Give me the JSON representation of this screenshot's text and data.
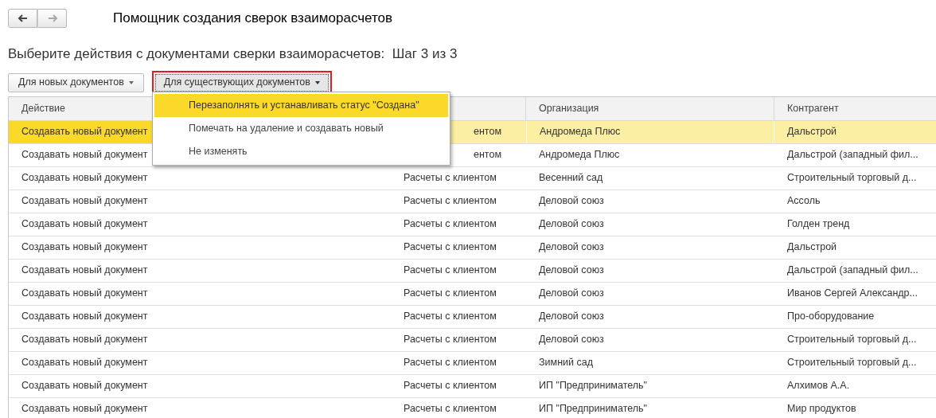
{
  "title": "Помощник создания сверок взаиморасчетов",
  "subtitle": "Выберите действия с документами сверки взаиморасчетов:  Шаг 3 из 3",
  "nav": [
    {
      "kind": "back",
      "disabled": false
    },
    {
      "kind": "forward",
      "disabled": true
    }
  ],
  "toolbar": [
    {
      "label": "Для новых документов",
      "focused": false,
      "open": false
    },
    {
      "label": "Для существующих документов",
      "focused": true,
      "open": true
    }
  ],
  "menu": [
    {
      "label": "Перезаполнять и устанавливать статус \"Создана\"",
      "selected": true
    },
    {
      "label": "Помечать на удаление и создавать новый",
      "selected": false
    },
    {
      "label": "Не изменять",
      "selected": false
    }
  ],
  "table": {
    "columns": {
      "action": "Действие",
      "organization": "Организация",
      "counterparty": "Контрагент"
    },
    "rows": [
      {
        "selected": true,
        "action": "Создавать новый документ",
        "column_2": "ентом",
        "column_2_partly_hidden": true,
        "organization": "Андромеда Плюс",
        "counterparty": "Дальстрой"
      },
      {
        "selected": false,
        "action": "Создавать новый документ",
        "column_2": "ентом",
        "column_2_partly_hidden": true,
        "organization": "Андромеда Плюс",
        "counterparty": "Дальстрой (западный фил..."
      },
      {
        "selected": false,
        "action": "Создавать новый документ",
        "column_2": "Расчеты с клиентом",
        "column_2_partly_hidden": false,
        "organization": "Весенний сад",
        "counterparty": "Строительный торговый д..."
      },
      {
        "selected": false,
        "action": "Создавать новый документ",
        "column_2": "Расчеты с клиентом",
        "column_2_partly_hidden": false,
        "organization": "Деловой союз",
        "counterparty": "Ассоль"
      },
      {
        "selected": false,
        "action": "Создавать новый документ",
        "column_2": "Расчеты с клиентом",
        "column_2_partly_hidden": false,
        "organization": "Деловой союз",
        "counterparty": "Голден тренд"
      },
      {
        "selected": false,
        "action": "Создавать новый документ",
        "column_2": "Расчеты с клиентом",
        "column_2_partly_hidden": false,
        "organization": "Деловой союз",
        "counterparty": "Дальстрой"
      },
      {
        "selected": false,
        "action": "Создавать новый документ",
        "column_2": "Расчеты с клиентом",
        "column_2_partly_hidden": false,
        "organization": "Деловой союз",
        "counterparty": "Дальстрой (западный фил..."
      },
      {
        "selected": false,
        "action": "Создавать новый документ",
        "column_2": "Расчеты с клиентом",
        "column_2_partly_hidden": false,
        "organization": "Деловой союз",
        "counterparty": "Иванов Сергей Александр..."
      },
      {
        "selected": false,
        "action": "Создавать новый документ",
        "column_2": "Расчеты с клиентом",
        "column_2_partly_hidden": false,
        "organization": "Деловой союз",
        "counterparty": "Про-оборудование"
      },
      {
        "selected": false,
        "action": "Создавать новый документ",
        "column_2": "Расчеты с клиентом",
        "column_2_partly_hidden": false,
        "organization": "Деловой союз",
        "counterparty": "Строительный торговый д..."
      },
      {
        "selected": false,
        "action": "Создавать новый документ",
        "column_2": "Расчеты с клиентом",
        "column_2_partly_hidden": false,
        "organization": "Зимний сад",
        "counterparty": "Строительный торговый д..."
      },
      {
        "selected": false,
        "action": "Создавать новый документ",
        "column_2": "Расчеты с клиентом",
        "column_2_partly_hidden": false,
        "organization": "ИП \"Предприниматель\"",
        "counterparty": "Алхимов А.А."
      },
      {
        "selected": false,
        "action": "Создавать новый документ",
        "column_2": "Расчеты с клиентом",
        "column_2_partly_hidden": false,
        "organization": "ИП \"Предприниматель\"",
        "counterparty": "Мир продуктов"
      }
    ]
  }
}
